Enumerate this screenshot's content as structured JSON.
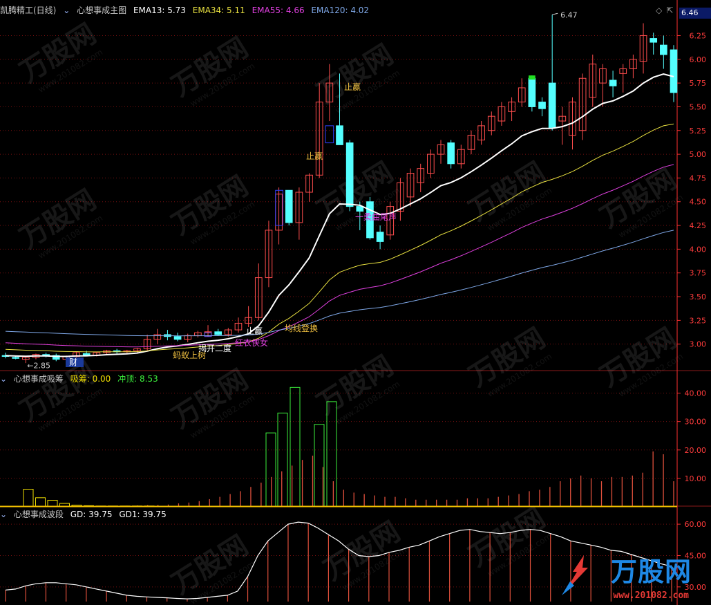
{
  "header": {
    "stock_name": "凯腾精工(日线)",
    "main_indicator": "心想事成主图",
    "ema13_label": "EMA13: 5.73",
    "ema34_label": "EMA34: 5.11",
    "ema55_label": "EMA55: 4.66",
    "ema120_label": "EMA120: 4.02",
    "current_price": "6.46"
  },
  "panel2": {
    "title": "心想事成吸筹",
    "xichou_label": "吸筹: 0.00",
    "chongding_label": "冲顶: 8.53"
  },
  "panel3": {
    "title": "心想事成波段",
    "gd_label": "GD: 39.75",
    "gd1_label": "GD1: 39.75"
  },
  "watermark": {
    "text": "万股网",
    "url": "www.201082.com"
  },
  "logo": {
    "text": "万股网",
    "url": "www.201082.com"
  },
  "colors": {
    "up": "#ff4d4d",
    "down": "#54ffff",
    "ema13": "#ffffff",
    "ema34": "#e8e040",
    "ema55": "#e040e0",
    "ema120": "#7fa8e8",
    "axis": "#ff3030"
  },
  "chart_data": [
    {
      "type": "candlestick",
      "name": "心想事成主图",
      "ylim": [
        2.75,
        6.45
      ],
      "yticks": [
        3.0,
        3.25,
        3.5,
        3.75,
        4.0,
        4.25,
        4.5,
        4.75,
        5.0,
        5.25,
        5.5,
        5.75,
        6.0,
        6.25
      ],
      "ohlc": [
        [
          2.88,
          2.91,
          2.85,
          2.87
        ],
        [
          2.86,
          2.88,
          2.84,
          2.85
        ],
        [
          2.84,
          2.87,
          2.8,
          2.86
        ],
        [
          2.86,
          2.9,
          2.84,
          2.89
        ],
        [
          2.89,
          2.91,
          2.86,
          2.88
        ],
        [
          2.88,
          2.9,
          2.82,
          2.84
        ],
        [
          2.84,
          2.88,
          2.82,
          2.87
        ],
        [
          2.87,
          2.92,
          2.86,
          2.91
        ],
        [
          2.9,
          2.93,
          2.87,
          2.88
        ],
        [
          2.88,
          2.92,
          2.87,
          2.91
        ],
        [
          2.91,
          2.94,
          2.89,
          2.93
        ],
        [
          2.93,
          2.95,
          2.9,
          2.92
        ],
        [
          2.92,
          2.94,
          2.9,
          2.93
        ],
        [
          2.93,
          2.96,
          2.91,
          2.95
        ],
        [
          2.95,
          3.1,
          2.93,
          3.05
        ],
        [
          3.05,
          3.16,
          3.0,
          3.1
        ],
        [
          3.1,
          3.15,
          3.04,
          3.08
        ],
        [
          3.08,
          3.12,
          3.03,
          3.05
        ],
        [
          3.05,
          3.11,
          3.02,
          3.09
        ],
        [
          3.09,
          3.14,
          3.07,
          3.12
        ],
        [
          3.12,
          3.2,
          3.08,
          3.13
        ],
        [
          3.13,
          3.16,
          3.09,
          3.1
        ],
        [
          3.1,
          3.17,
          3.08,
          3.15
        ],
        [
          3.15,
          3.28,
          3.12,
          3.22
        ],
        [
          3.22,
          3.4,
          3.18,
          3.28
        ],
        [
          3.28,
          3.85,
          3.25,
          3.7
        ],
        [
          3.7,
          4.3,
          3.6,
          4.2
        ],
        [
          4.2,
          4.65,
          4.05,
          4.58
        ],
        [
          4.62,
          4.62,
          4.25,
          4.28
        ],
        [
          4.28,
          4.65,
          4.1,
          4.6
        ],
        [
          4.6,
          4.8,
          4.5,
          4.78
        ],
        [
          4.78,
          5.75,
          4.75,
          5.55
        ],
        [
          5.55,
          5.95,
          5.35,
          5.75
        ],
        [
          5.3,
          5.85,
          5.2,
          5.1
        ],
        [
          5.12,
          5.15,
          4.4,
          4.45
        ],
        [
          4.45,
          4.5,
          4.2,
          4.4
        ],
        [
          4.5,
          4.55,
          4.1,
          4.12
        ],
        [
          4.18,
          4.25,
          4.0,
          4.08
        ],
        [
          4.15,
          4.5,
          4.1,
          4.45
        ],
        [
          4.4,
          4.75,
          4.3,
          4.7
        ],
        [
          4.55,
          4.85,
          4.45,
          4.8
        ],
        [
          4.7,
          4.9,
          4.6,
          4.85
        ],
        [
          4.8,
          5.05,
          4.75,
          5.0
        ],
        [
          5.0,
          5.15,
          4.9,
          5.1
        ],
        [
          5.12,
          5.15,
          4.85,
          4.9
        ],
        [
          4.9,
          5.1,
          4.85,
          5.05
        ],
        [
          5.05,
          5.25,
          5.0,
          5.2
        ],
        [
          5.15,
          5.35,
          5.1,
          5.3
        ],
        [
          5.25,
          5.45,
          5.2,
          5.4
        ],
        [
          5.35,
          5.55,
          5.3,
          5.5
        ],
        [
          5.45,
          5.6,
          5.35,
          5.55
        ],
        [
          5.55,
          5.8,
          5.5,
          5.7
        ],
        [
          5.8,
          5.83,
          5.45,
          5.5
        ],
        [
          5.55,
          5.6,
          5.4,
          5.48
        ],
        [
          5.75,
          6.47,
          5.25,
          5.28
        ],
        [
          5.35,
          5.5,
          5.1,
          5.4
        ],
        [
          5.2,
          5.6,
          5.05,
          5.55
        ],
        [
          5.25,
          5.85,
          5.15,
          5.8
        ],
        [
          5.6,
          6.05,
          5.5,
          5.95
        ],
        [
          5.75,
          5.95,
          5.5,
          5.9
        ],
        [
          5.78,
          5.88,
          5.6,
          5.72
        ],
        [
          5.85,
          5.95,
          5.65,
          5.9
        ],
        [
          5.9,
          6.05,
          5.8,
          6.0
        ],
        [
          5.98,
          6.38,
          5.85,
          6.25
        ],
        [
          6.22,
          6.28,
          6.05,
          6.18
        ],
        [
          6.15,
          6.25,
          5.9,
          6.05
        ],
        [
          6.1,
          6.15,
          5.55,
          5.65
        ]
      ],
      "markers": [
        {
          "value": 2.85,
          "label": "←2.85"
        },
        {
          "value": 6.47,
          "label": "6.47"
        }
      ],
      "annotations": [
        "财",
        "蚂蚁上树",
        "揭开二度",
        "红衣侠女",
        "止赢",
        "均线登换",
        "止赢",
        "止赢",
        "一柔曲尾声"
      ]
    },
    {
      "type": "bar",
      "name": "心想事成吸筹",
      "ylim": [
        0,
        45
      ],
      "yticks": [
        10.0,
        20.0,
        30.0,
        40.0
      ],
      "xichou": [
        6.2,
        3.2,
        2.3,
        1.2,
        0.6,
        0.4,
        0.3,
        0.3,
        0.3,
        0.3,
        0.3
      ],
      "chongding": [
        26,
        33,
        42,
        29,
        37
      ],
      "values": [
        0.4,
        0.5,
        0.6,
        0.7,
        0.8,
        1.2,
        1.5,
        2.0,
        2.7,
        3.5,
        4.5,
        5.5,
        7.0,
        8.5,
        10.5,
        12.5,
        14.5,
        16.5,
        18.0,
        14.0,
        9.0,
        6.0,
        5.0,
        4.5,
        4.0,
        3.5,
        3.5,
        3.0,
        2.5,
        2.5,
        2.5,
        2.5,
        2.5,
        3.0,
        3.0,
        3.0,
        3.5,
        4.0,
        4.5,
        5.5,
        6.0,
        7.0,
        9.0,
        10.0,
        11.0,
        10.0,
        9.0,
        10.5,
        10.5,
        11.0,
        12.0,
        19.5,
        18.5,
        9.0
      ]
    },
    {
      "type": "line",
      "name": "心想事成波段",
      "ylim": [
        23,
        64
      ],
      "yticks": [
        30.0,
        45.0,
        60.0
      ],
      "values": [
        28.5,
        29.0,
        30.5,
        31.5,
        32.0,
        32.0,
        31.5,
        31.0,
        30.0,
        29.0,
        28.0,
        27.0,
        26.0,
        25.5,
        25.2,
        25.0,
        24.8,
        24.5,
        24.3,
        24.5,
        25.0,
        25.5,
        26.0,
        28.0,
        35.0,
        45.0,
        52.0,
        56.0,
        60.0,
        61.0,
        60.5,
        58.0,
        55.0,
        52.0,
        48.0,
        45.0,
        44.5,
        45.0,
        46.5,
        47.5,
        49.0,
        50.0,
        52.0,
        54.0,
        55.5,
        57.0,
        57.5,
        56.5,
        56.0,
        55.5,
        56.0,
        57.0,
        57.5,
        57.0,
        55.5,
        54.0,
        52.0,
        51.0,
        50.0,
        49.0,
        47.5,
        47.0,
        45.5,
        44.0,
        42.5,
        41.0,
        39.75
      ]
    }
  ]
}
